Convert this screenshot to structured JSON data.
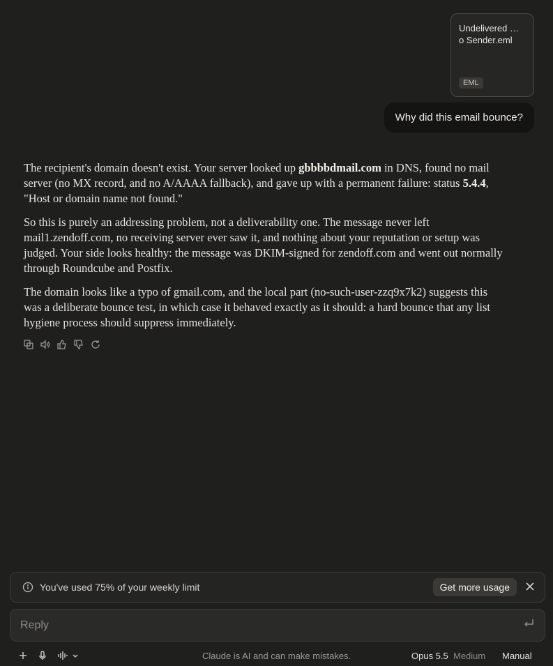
{
  "attachment": {
    "file_name": "Undelivered …o Sender.eml",
    "file_name_line1": "Undelivered …",
    "file_name_line2": "o Sender.eml",
    "file_type": "EML"
  },
  "user_message": "Why did this email bounce?",
  "assistant": {
    "p1": {
      "a": "The recipient's domain doesn't exist. Your server looked up ",
      "b": "gbbbbdmail.com",
      "c": " in DNS, found no mail server (no MX record, and no A/AAAA fallback), and gave up with a permanent failure: status ",
      "d": "5.4.4",
      "e": ", \"Host or domain name not found.\""
    },
    "p2": "So this is purely an addressing problem, not a deliverability one. The message never left mail1.zendoff.com, no receiving server ever saw it, and nothing about your reputation or setup was judged. Your side looks healthy: the message was DKIM-signed for zendoff.com and went out normally through Roundcube and Postfix.",
    "p3": "The domain looks like a typo of gmail.com, and the local part (no-such-user-zzq9x7k2) suggests this was a deliberate bounce test, in which case it behaved exactly as it should: a hard bounce that any list hygiene process should suppress immediately."
  },
  "actions": [
    "copy-icon",
    "speaker-icon",
    "thumbs-up-icon",
    "thumbs-down-icon",
    "retry-icon"
  ],
  "usage": {
    "text": "You've used 75% of your weekly limit",
    "button": "Get more usage"
  },
  "reply": {
    "placeholder": "Reply"
  },
  "footer": {
    "disclaimer": "Claude is AI and can make mistakes.",
    "model": "Opus 5.5",
    "effort": "Medium",
    "mode": "Manual"
  }
}
